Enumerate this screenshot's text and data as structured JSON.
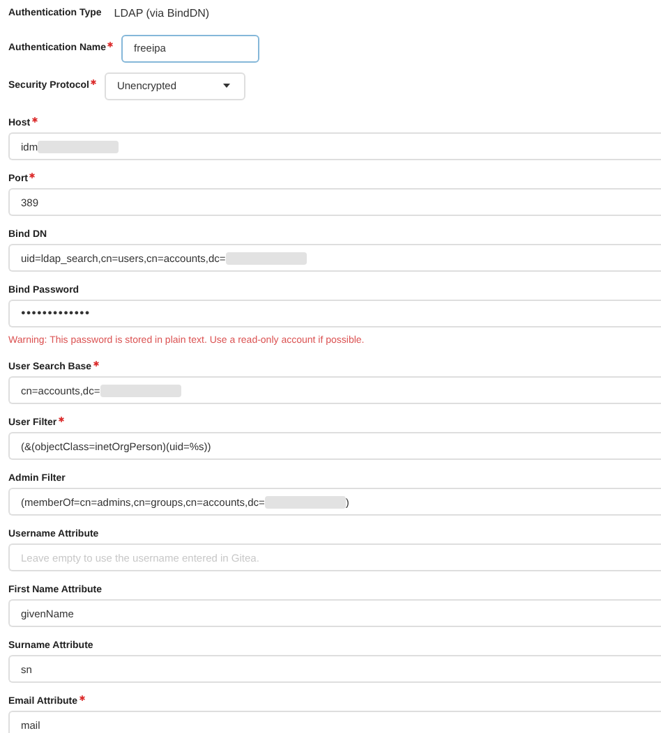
{
  "auth_type": {
    "label": "Authentication Type",
    "value": "LDAP (via BindDN)"
  },
  "auth_name": {
    "label": "Authentication Name",
    "required": true,
    "value": "freeipa"
  },
  "security_protocol": {
    "label": "Security Protocol",
    "required": true,
    "value": "Unencrypted"
  },
  "fields": [
    {
      "label": "Host",
      "required": true,
      "kind": "text",
      "value": "idm",
      "redacted": true
    },
    {
      "label": "Port",
      "required": true,
      "kind": "text",
      "value": "389",
      "redacted": false
    },
    {
      "label": "Bind DN",
      "required": false,
      "kind": "text",
      "value": "uid=ldap_search,cn=users,cn=accounts,dc=",
      "redacted": true
    },
    {
      "label": "Bind Password",
      "required": false,
      "kind": "password",
      "value": "●●●●●●●●●●●●●",
      "redacted": false,
      "warning": "Warning: This password is stored in plain text. Use a read-only account if possible."
    },
    {
      "label": "User Search Base",
      "required": true,
      "kind": "text",
      "value": "cn=accounts,dc=",
      "redacted": true
    },
    {
      "label": "User Filter",
      "required": true,
      "kind": "text",
      "value": "(&(objectClass=inetOrgPerson)(uid=%s))",
      "redacted": false
    },
    {
      "label": "Admin Filter",
      "required": false,
      "kind": "text",
      "value": "(memberOf=cn=admins,cn=groups,cn=accounts,dc=",
      "suffix": ")",
      "redacted": true
    },
    {
      "label": "Username Attribute",
      "required": false,
      "kind": "text",
      "placeholder": "Leave empty to use the username entered in Gitea.",
      "redacted": false
    },
    {
      "label": "First Name Attribute",
      "required": false,
      "kind": "text",
      "value": "givenName",
      "redacted": false
    },
    {
      "label": "Surname Attribute",
      "required": false,
      "kind": "text",
      "value": "sn",
      "redacted": false
    },
    {
      "label": "Email Attribute",
      "required": true,
      "kind": "text",
      "value": "mail",
      "redacted": false
    }
  ]
}
